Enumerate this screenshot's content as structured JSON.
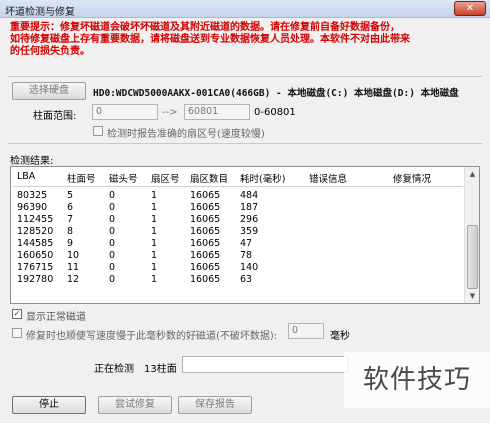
{
  "window": {
    "title": "坏道检测与修复",
    "close_label": "✕"
  },
  "warning": {
    "lines": [
      "重要提示：修复坏磁道会破坏坏磁道及其附近磁道的数据。请在修复前自备好数据备份，",
      "如待修复磁盘上存有重要数据，请将磁盘送到专业数据恢复人员处理。本软件不对由此带来",
      "的任何损失负责。"
    ]
  },
  "disk": {
    "select_button": "选择硬盘",
    "info": "HD0:WDCWD5000AAKX-001CA0(466GB) - 本地磁盘(C:) 本地磁盘(D:) 本地磁盘"
  },
  "range": {
    "label": "柱面范围:",
    "start_value": "0",
    "arrow": "-->",
    "end_value": "60801",
    "range_text": "0-60801",
    "report_accurate_label": "检测时报告准确的扇区号(速度较慢)"
  },
  "results": {
    "label": "检测结果:",
    "columns": [
      "LBA",
      "柱面号",
      "磁头号",
      "扇区号",
      "扇区数目",
      "耗时(毫秒)",
      "错误信息",
      "修复情况"
    ],
    "rows": [
      [
        "80325",
        "5",
        "0",
        "1",
        "16065",
        "484",
        "",
        ""
      ],
      [
        "96390",
        "6",
        "0",
        "1",
        "16065",
        "187",
        "",
        ""
      ],
      [
        "112455",
        "7",
        "0",
        "1",
        "16065",
        "296",
        "",
        ""
      ],
      [
        "128520",
        "8",
        "0",
        "1",
        "16065",
        "359",
        "",
        ""
      ],
      [
        "144585",
        "9",
        "0",
        "1",
        "16065",
        "47",
        "",
        ""
      ],
      [
        "160650",
        "10",
        "0",
        "1",
        "16065",
        "78",
        "",
        ""
      ],
      [
        "176715",
        "11",
        "0",
        "1",
        "16065",
        "140",
        "",
        ""
      ],
      [
        "192780",
        "12",
        "0",
        "1",
        "16065",
        "63",
        "",
        ""
      ]
    ]
  },
  "options": {
    "show_normal_label": "显示正常磁道",
    "show_normal_checked": "✓",
    "repair_slow_label": "修复时也顺便写速度慢于此毫秒数的好磁道(不破坏数据):",
    "slow_ms_value": "0",
    "ms_unit": "毫秒"
  },
  "status": {
    "label": "正在检测",
    "current": "13柱面"
  },
  "buttons": {
    "stop": "停止",
    "try_repair": "尝试修复",
    "save_report": "保存报告"
  },
  "watermark": "软件技巧"
}
